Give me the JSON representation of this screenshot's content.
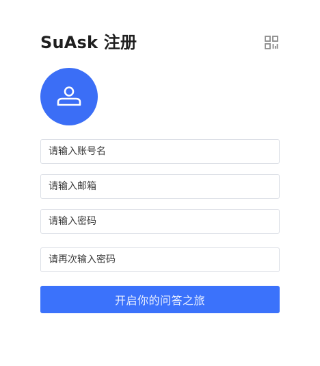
{
  "header": {
    "title": "SuAsk 注册",
    "qr_icon": "qr-code-icon"
  },
  "avatar": {
    "icon": "user-icon",
    "color": "#3b6ef6"
  },
  "form": {
    "username_placeholder": "请输入账号名",
    "email_placeholder": "请输入邮箱",
    "password_placeholder": "请输入密码",
    "confirm_password_placeholder": "请再次输入密码",
    "submit_label": "开启你的问答之旅"
  },
  "colors": {
    "accent": "#3b72fb",
    "border": "#dcdfe6"
  }
}
